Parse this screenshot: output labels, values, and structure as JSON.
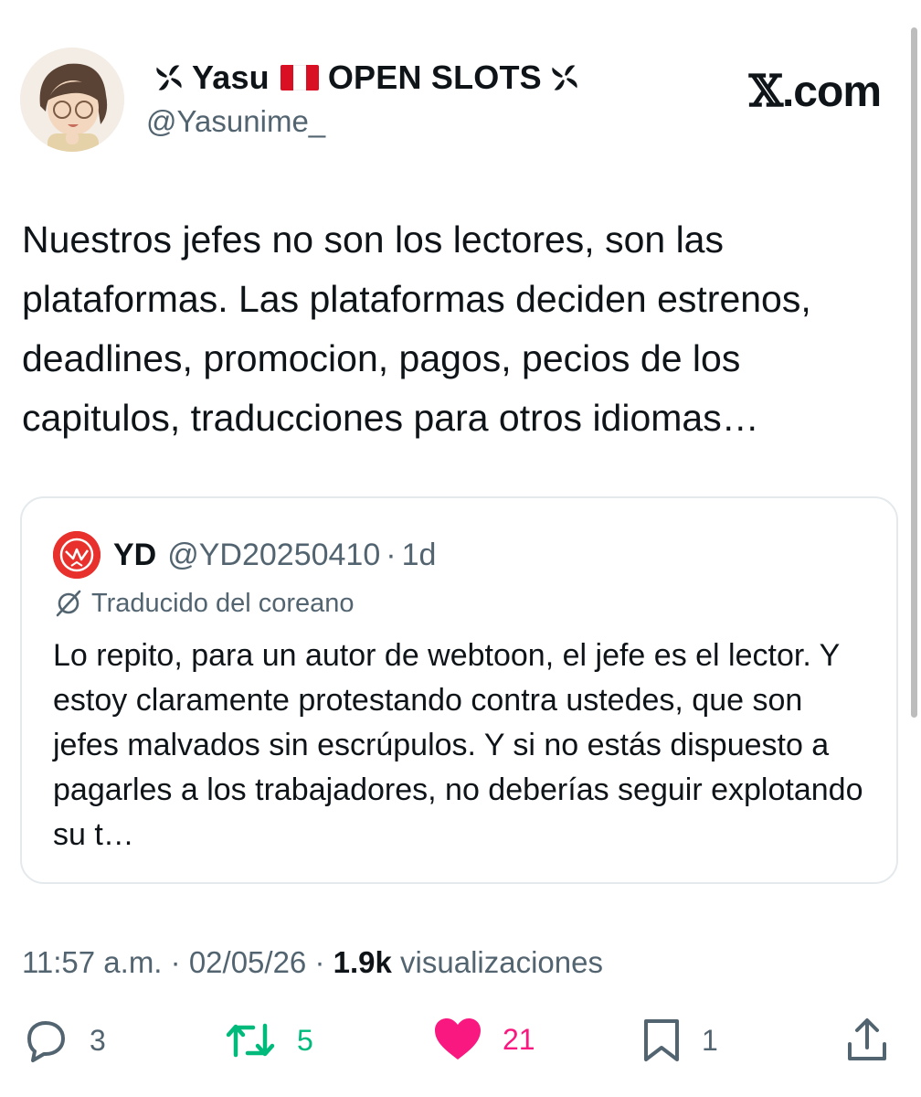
{
  "author": {
    "display_name_prefix_icon": "pinwheel-icon",
    "name": "Yasu",
    "flag_icon": "peru-flag-icon",
    "name_suffix": "OPEN SLOTS",
    "display_name_suffix_icon": "pinwheel-icon",
    "handle": "@Yasunime_"
  },
  "brand": {
    "x_glyph": "𝕏",
    "domain": ".com"
  },
  "tweet": {
    "text": "Nuestros jefes no son los lectores, son las plataformas. Las plataformas deciden estrenos, deadlines, promocion, pagos, pecios de los capitulos, traducciones para otros idiomas…"
  },
  "quote": {
    "name": "YD",
    "handle": "@YD20250410",
    "separator": "·",
    "age": "1d",
    "translated_label": "Traducido del coreano",
    "text": "Lo repito, para un autor de webtoon, el jefe es el lector. Y estoy claramente protestando contra ustedes, que son jefes malvados sin escrúpulos. Y si no estás dispuesto a pagarles a los trabajadores, no deberías seguir explotando su t…"
  },
  "meta": {
    "time": "11:57 a.m.",
    "sep1": "·",
    "date": "02/05/26",
    "sep2": "·",
    "views_count": "1.9k",
    "views_label": "visualizaciones"
  },
  "actions": {
    "replies": "3",
    "reposts": "5",
    "likes": "21",
    "bookmarks": "1"
  },
  "colors": {
    "text": "#0f1419",
    "secondary": "#536471",
    "repost": "#00ba7c",
    "like": "#f91880",
    "border": "#e4e9ec",
    "quote_avatar": "#e8312c"
  }
}
